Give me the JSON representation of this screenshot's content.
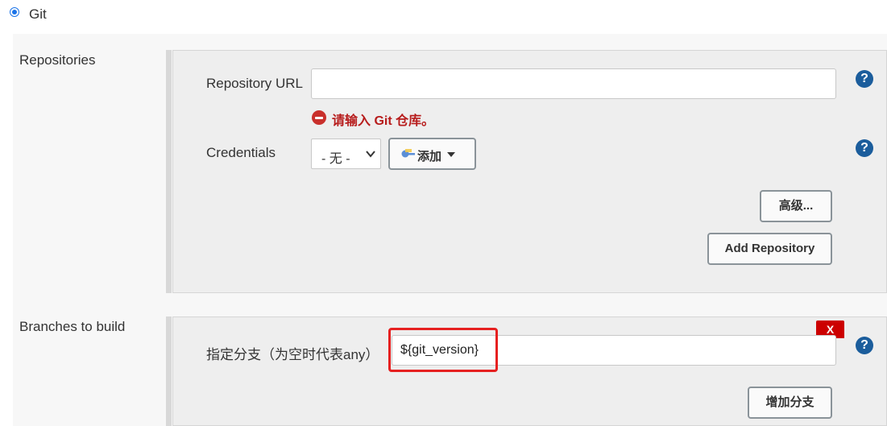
{
  "scm": {
    "option_label": "Git",
    "selected": true
  },
  "repositories": {
    "section_label": "Repositories",
    "url_label": "Repository URL",
    "url_value": "",
    "error_message": "请输入 Git 仓库。",
    "credentials_label": "Credentials",
    "credentials_selected": "- 无 -",
    "add_button_label": "添加",
    "advanced_button_label": "高级...",
    "add_repository_label": "Add Repository",
    "help_glyph": "?"
  },
  "branches": {
    "section_label": "Branches to build",
    "specifier_label": "指定分支（为空时代表any）",
    "specifier_value": "${git_version}",
    "delete_label": "X",
    "add_branch_label": "增加分支",
    "help_glyph": "?"
  },
  "colors": {
    "accent": "#1b5d9c",
    "error": "#b71c1c",
    "delete": "#cc0000",
    "highlight": "#e62020"
  },
  "icons": [
    "radio-icon",
    "help-icon",
    "error-icon",
    "key-icon",
    "chevron-down-icon"
  ]
}
